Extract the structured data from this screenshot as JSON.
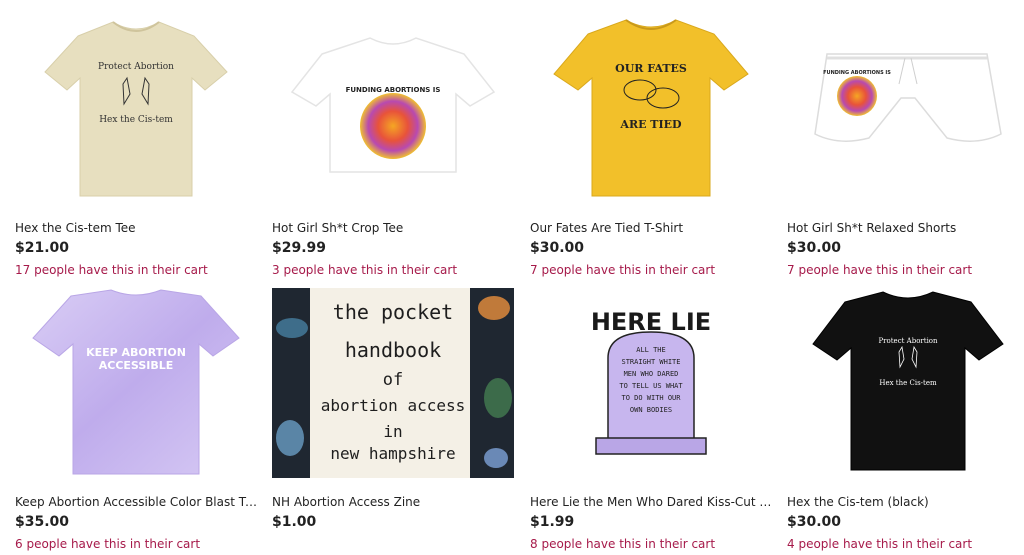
{
  "products": [
    {
      "title": "Hex the Cis-tem Tee",
      "price": "$21.00",
      "cart_note": "17 people have this in their cart",
      "image_text": [
        "Protect Abortion",
        "Hex the Cis-tem"
      ],
      "color": "#e7dfbf"
    },
    {
      "title": "Hot Girl Sh*t Crop Tee",
      "price": "$29.99",
      "cart_note": "3 people have this in their cart",
      "image_text": [
        "FUNDING ABORTIONS IS"
      ],
      "color": "#ffffff"
    },
    {
      "title": "Our Fates Are Tied T-Shirt",
      "price": "$30.00",
      "cart_note": "7 people have this in their cart",
      "image_text": [
        "OUR FATES",
        "ARE TIED"
      ],
      "color": "#f2c02a"
    },
    {
      "title": "Hot Girl Sh*t Relaxed Shorts",
      "price": "$30.00",
      "cart_note": "7 people have this in their cart",
      "image_text": [
        "FUNDING ABORTIONS IS"
      ],
      "color": "#ffffff"
    },
    {
      "title": "Keep Abortion Accessible Color Blast T-...",
      "price": "$35.00",
      "cart_note": "6 people have this in their cart",
      "image_text": [
        "KEEP ABORTION",
        "ACCESSIBLE"
      ],
      "color": "#c9b8ef"
    },
    {
      "title": "NH Abortion Access Zine",
      "price": "$1.00",
      "cart_note": "",
      "image_text": [
        "the pocket",
        "handbook",
        "of",
        "abortion access",
        "in",
        "new hampshire"
      ],
      "color": "#f4f0e6"
    },
    {
      "title": "Here Lie the Men Who Dared Kiss-Cut S...",
      "price": "$1.99",
      "cart_note": "8 people have this in their cart",
      "image_text": [
        "HERE LIE",
        "ALL THE",
        "STRAIGHT WHITE",
        "MEN WHO DARED",
        "TO TELL US WHAT",
        "TO DO WITH OUR",
        "OWN BODIES"
      ],
      "color": "#c7b6ee"
    },
    {
      "title": "Hex the Cis-tem (black)",
      "price": "$30.00",
      "cart_note": "4 people have this in their cart",
      "image_text": [
        "Protect Abortion",
        "Hex the Cis-tem"
      ],
      "color": "#111111"
    }
  ]
}
